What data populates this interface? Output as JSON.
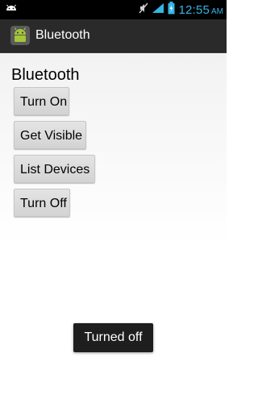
{
  "status_bar": {
    "time": "12:55",
    "ampm": "AM",
    "icons": [
      "android-icon",
      "mute-icon",
      "signal-icon",
      "battery-icon"
    ]
  },
  "action_bar": {
    "title": "Bluetooth",
    "icon": "android-app-icon"
  },
  "main": {
    "heading": "Bluetooth",
    "buttons": {
      "turn_on": "Turn On",
      "get_visible": "Get Visible",
      "list_devices": "List Devices",
      "turn_off": "Turn Off"
    }
  },
  "toast": {
    "message": "Turned off"
  },
  "colors": {
    "status_time": "#34b5e5",
    "action_bar": "#2a2a2a",
    "button": "#d9d9d9",
    "toast_bg": "#1e1e1e"
  }
}
